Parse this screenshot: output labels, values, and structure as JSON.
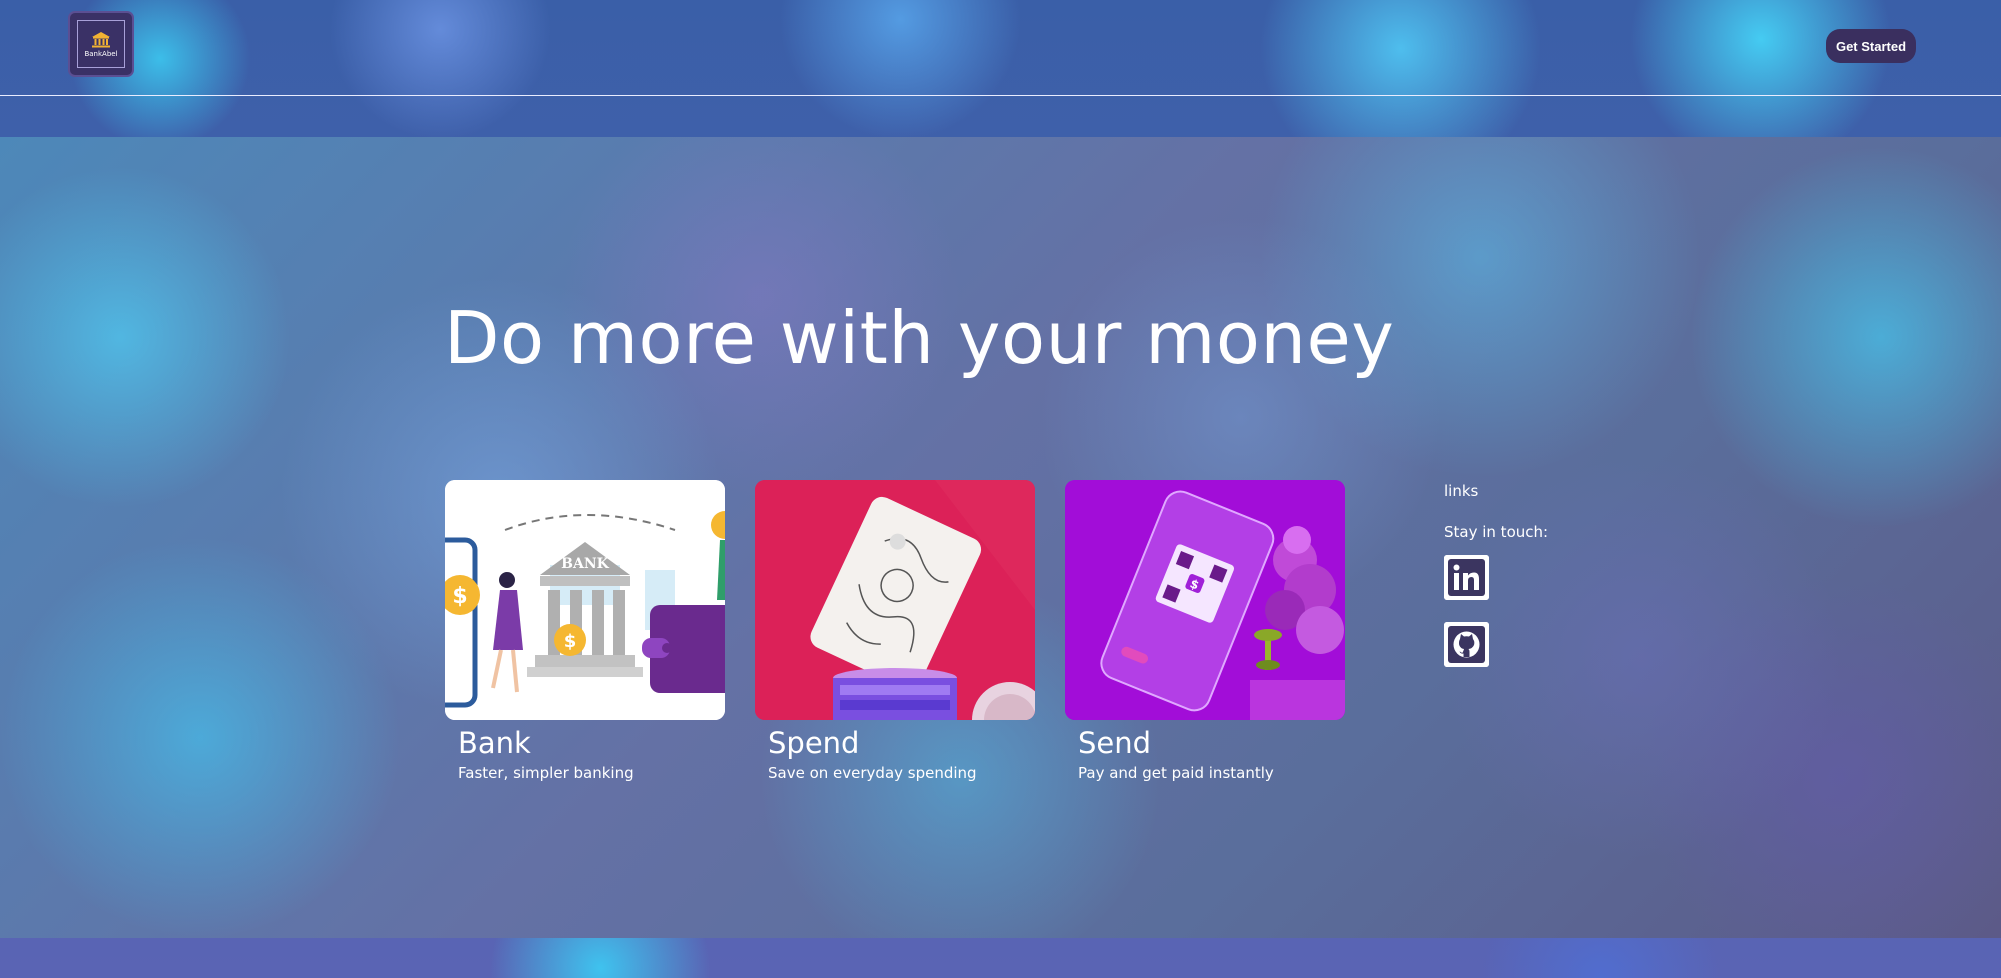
{
  "header": {
    "logo_text": "BankAbel",
    "get_started_label": "Get Started"
  },
  "hero": {
    "headline": "Do more with your money"
  },
  "cards": [
    {
      "title": "Bank",
      "subtitle": "Faster, simpler banking",
      "image_text": "BANK",
      "image_bg": "#ffffff"
    },
    {
      "title": "Spend",
      "subtitle": "Save on everyday spending",
      "image_bg": "#dc2158"
    },
    {
      "title": "Send",
      "subtitle": "Pay and get paid instantly",
      "image_bg": "#a20dd8"
    }
  ],
  "sidebar": {
    "links_title": "links",
    "stay_label": "Stay in touch:",
    "socials": [
      {
        "name": "linkedin-icon"
      },
      {
        "name": "github-icon"
      }
    ]
  },
  "colors": {
    "button_bg": "#3a2f5f",
    "logo_bg": "#3a3166",
    "bank_purple": "#7b3ba8",
    "spend_pink": "#dc2158",
    "send_purple": "#a20dd8"
  }
}
